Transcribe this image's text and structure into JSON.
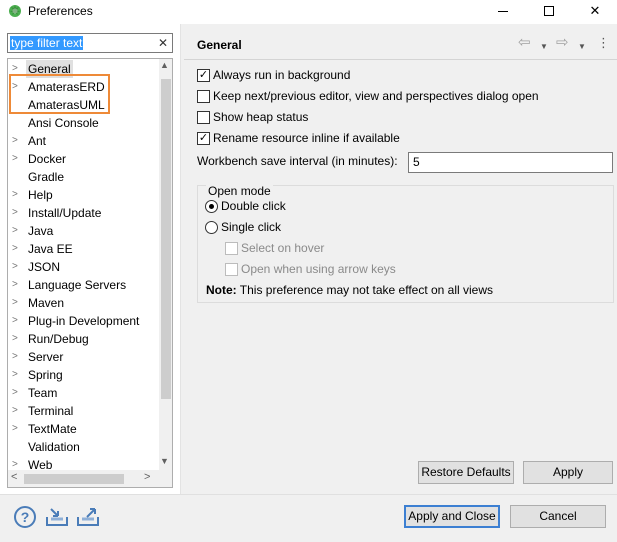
{
  "window": {
    "title": "Preferences",
    "icon": "eclipse-icon",
    "minimize_icon": "minimize-icon",
    "maximize_icon": "maximize-icon",
    "close_glyph": "✕"
  },
  "filter": {
    "text": "type filter text",
    "clear_glyph": "✕"
  },
  "tree": {
    "items": [
      {
        "label": "General",
        "expandable": true,
        "selected": true
      },
      {
        "label": "AmaterasERD",
        "expandable": true
      },
      {
        "label": "AmaterasUML",
        "expandable": false
      },
      {
        "label": "Ansi Console",
        "expandable": false
      },
      {
        "label": "Ant",
        "expandable": true
      },
      {
        "label": "Docker",
        "expandable": true
      },
      {
        "label": "Gradle",
        "expandable": false
      },
      {
        "label": "Help",
        "expandable": true
      },
      {
        "label": "Install/Update",
        "expandable": true
      },
      {
        "label": "Java",
        "expandable": true
      },
      {
        "label": "Java EE",
        "expandable": true
      },
      {
        "label": "JSON",
        "expandable": true
      },
      {
        "label": "Language Servers",
        "expandable": true
      },
      {
        "label": "Maven",
        "expandable": true
      },
      {
        "label": "Plug-in Development",
        "expandable": true
      },
      {
        "label": "Run/Debug",
        "expandable": true
      },
      {
        "label": "Server",
        "expandable": true
      },
      {
        "label": "Spring",
        "expandable": true
      },
      {
        "label": "Team",
        "expandable": true
      },
      {
        "label": "Terminal",
        "expandable": true
      },
      {
        "label": "TextMate",
        "expandable": true
      },
      {
        "label": "Validation",
        "expandable": false
      },
      {
        "label": "Web",
        "expandable": true
      }
    ],
    "arrow_glyph": ">",
    "highlight_color": "#ee8a38"
  },
  "page": {
    "title": "General",
    "back_icon": "back-arrow-icon",
    "forward_icon": "forward-arrow-icon",
    "menu_icon": "kebab-menu-icon",
    "options": [
      {
        "label": "Always run in background",
        "checked": true
      },
      {
        "label": "Keep next/previous editor, view and perspectives dialog open",
        "checked": false
      },
      {
        "label": "Show heap status",
        "checked": false
      },
      {
        "label": "Rename resource inline if available",
        "checked": true
      }
    ],
    "interval_label": "Workbench save interval (in minutes):",
    "interval_value": "5",
    "open_mode": {
      "label": "Open mode",
      "double_click": "Double click",
      "single_click": "Single click",
      "selected": "Double click",
      "select_on_hover": "Select on hover",
      "open_arrow_keys": "Open when using arrow keys",
      "note_bold": "Note:",
      "note_text": " This preference may not take effect on all views"
    },
    "restore_defaults": "Restore Defaults",
    "apply": "Apply"
  },
  "footer": {
    "help_glyph": "?",
    "import_icon": "import-icon",
    "export_icon": "export-icon",
    "apply_and_close": "Apply and Close",
    "cancel": "Cancel"
  },
  "colors": {
    "accent": "#3c7fd2",
    "selection": "#3399ff",
    "panel": "#f0f0f0"
  }
}
